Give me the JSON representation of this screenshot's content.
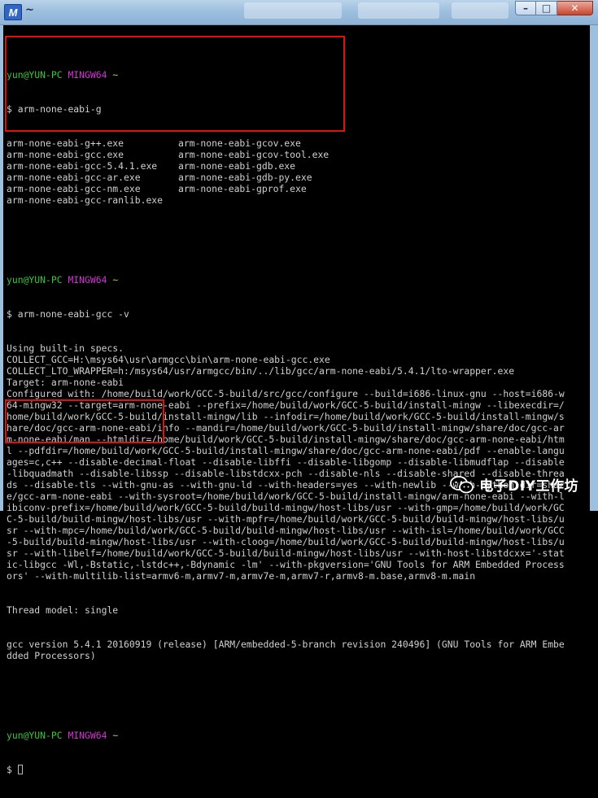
{
  "window": {
    "title_icon_letter": "M",
    "title_menu_glyph": "~",
    "buttons": {
      "minimize": "–",
      "maximize": "□",
      "close": "✕"
    }
  },
  "terminal": {
    "prompt": {
      "user": "yun@YUN-PC",
      "env": "MINGW64",
      "path": "~",
      "symbol": "$"
    },
    "block1": {
      "command": "arm-none-eabi-g",
      "completions": [
        [
          "arm-none-eabi-g++.exe",
          "arm-none-eabi-gcov.exe"
        ],
        [
          "arm-none-eabi-gcc.exe",
          "arm-none-eabi-gcov-tool.exe"
        ],
        [
          "arm-none-eabi-gcc-5.4.1.exe",
          "arm-none-eabi-gdb.exe"
        ],
        [
          "arm-none-eabi-gcc-ar.exe",
          "arm-none-eabi-gdb-py.exe"
        ],
        [
          "arm-none-eabi-gcc-nm.exe",
          "arm-none-eabi-gprof.exe"
        ],
        [
          "arm-none-eabi-gcc-ranlib.exe",
          ""
        ]
      ]
    },
    "block2": {
      "command": "arm-none-eabi-gcc -v",
      "output": [
        "Using built-in specs.",
        "COLLECT_GCC=H:\\msys64\\usr\\armgcc\\bin\\arm-none-eabi-gcc.exe",
        "COLLECT_LTO_WRAPPER=h:/msys64/usr/armgcc/bin/../lib/gcc/arm-none-eabi/5.4.1/lto-wrapper.exe",
        "Target: arm-none-eabi",
        "Configured with: /home/build/work/GCC-5-build/src/gcc/configure --build=i686-linux-gnu --host=i686-w",
        "64-mingw32 --target=arm-none-eabi --prefix=/home/build/work/GCC-5-build/install-mingw --libexecdir=/",
        "home/build/work/GCC-5-build/install-mingw/lib --infodir=/home/build/work/GCC-5-build/install-mingw/s",
        "hare/doc/gcc-arm-none-eabi/info --mandir=/home/build/work/GCC-5-build/install-mingw/share/doc/gcc-ar",
        "m-none-eabi/man --htmldir=/home/build/work/GCC-5-build/install-mingw/share/doc/gcc-arm-none-eabi/htm",
        "l --pdfdir=/home/build/work/GCC-5-build/install-mingw/share/doc/gcc-arm-none-eabi/pdf --enable-langu",
        "ages=c,c++ --disable-decimal-float --disable-libffi --disable-libgomp --disable-libmudflap --disable",
        "-libquadmath --disable-libssp --disable-libstdcxx-pch --disable-nls --disable-shared --disable-threa",
        "ds --disable-tls --with-gnu-as --with-gnu-ld --with-headers=yes --with-newlib --with-python-dir=shar",
        "e/gcc-arm-none-eabi --with-sysroot=/home/build/work/GCC-5-build/install-mingw/arm-none-eabi --with-l",
        "ibiconv-prefix=/home/build/work/GCC-5-build/build-mingw/host-libs/usr --with-gmp=/home/build/work/GC",
        "C-5-build/build-mingw/host-libs/usr --with-mpfr=/home/build/work/GCC-5-build/build-mingw/host-libs/u",
        "sr --with-mpc=/home/build/work/GCC-5-build/build-mingw/host-libs/usr --with-isl=/home/build/work/GCC",
        "-5-build/build-mingw/host-libs/usr --with-cloog=/home/build/work/GCC-5-build/build-mingw/host-libs/u",
        "sr --with-libelf=/home/build/work/GCC-5-build/build-mingw/host-libs/usr --with-host-libstdcxx='-stat",
        "ic-libgcc -Wl,-Bstatic,-lstdc++,-Bdynamic -lm' --with-pkgversion='GNU Tools for ARM Embedded Process",
        "ors' --with-multilib-list=armv6-m,armv7-m,armv7e-m,armv7-r,armv8-m.base,armv8-m.main"
      ],
      "thread_model": "Thread model: single",
      "version_lines": [
        "gcc version 5.4.1 20160919 (release) [ARM/embedded-5-branch revision 240496] (GNU Tools for ARM Embe",
        "dded Processors)"
      ]
    }
  },
  "watermark": {
    "text": "电子DIY工作坊",
    "icon": "wechat-icon"
  },
  "colors": {
    "prompt_user": "#39c53a",
    "prompt_env": "#d035d0",
    "prompt_path": "#c8c83a",
    "highlight": "#e01010"
  }
}
